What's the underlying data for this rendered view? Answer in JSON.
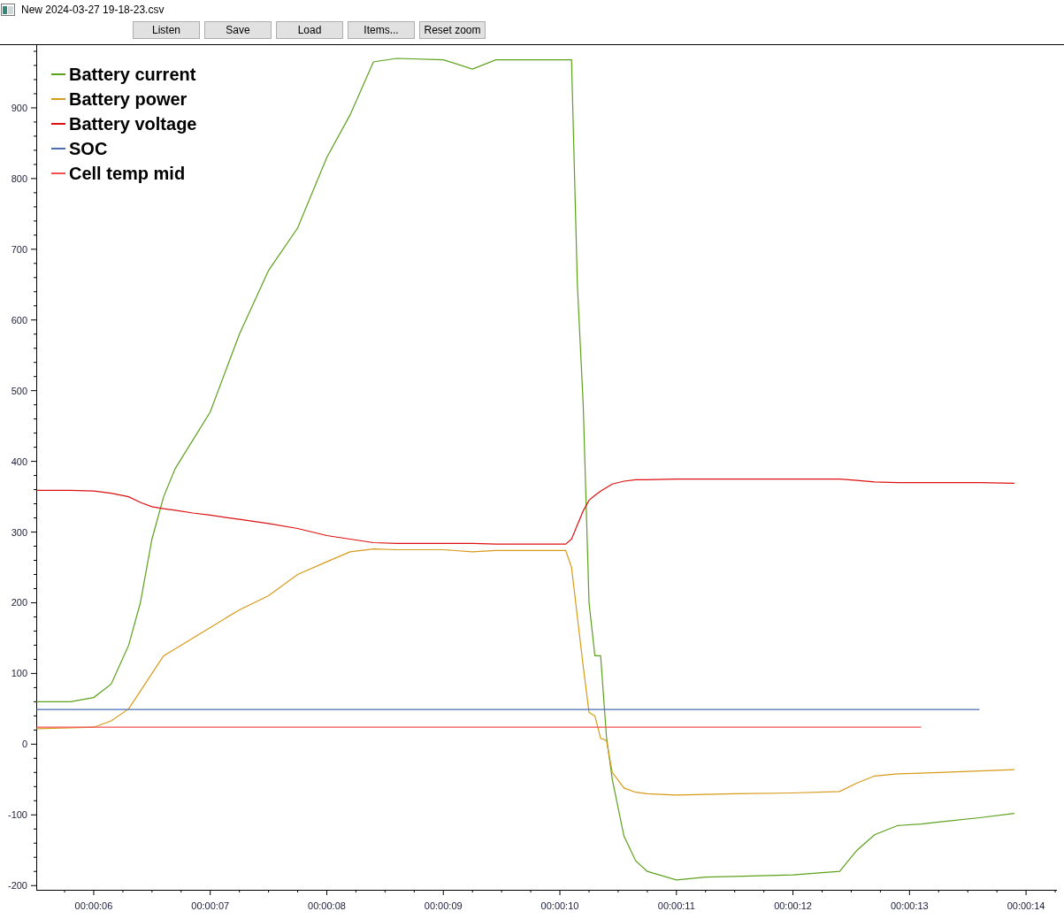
{
  "window": {
    "title": "New 2024-03-27 19-18-23.csv"
  },
  "toolbar": {
    "buttons": [
      "Listen",
      "Save",
      "Load",
      "Items...",
      "Reset zoom"
    ]
  },
  "chart": {
    "chart_data": {
      "type": "line",
      "legend": true,
      "x": [
        5.51,
        5.8,
        6.0,
        6.15,
        6.3,
        6.4,
        6.5,
        6.6,
        6.7,
        6.85,
        7.0,
        7.25,
        7.5,
        7.75,
        8.0,
        8.2,
        8.4,
        8.6,
        9.0,
        9.25,
        9.45,
        9.75,
        10.05,
        10.1,
        10.15,
        10.2,
        10.25,
        10.3,
        10.35,
        10.4,
        10.45,
        10.55,
        10.65,
        10.75,
        11.0,
        11.25,
        11.5,
        12.0,
        12.4,
        12.55,
        12.7,
        12.9,
        13.1,
        13.25,
        13.6,
        13.9
      ],
      "series": [
        {
          "name": "Battery current",
          "color": "#5ca01c",
          "values": [
            60,
            60,
            66,
            85,
            140,
            200,
            290,
            350,
            390,
            430,
            470,
            580,
            670,
            730,
            830,
            890,
            965,
            970,
            968,
            955,
            968,
            968,
            968,
            968,
            650,
            480,
            200,
            125,
            125,
            10,
            -50,
            -130,
            -165,
            -180,
            -192,
            -188,
            -187,
            -185,
            -180,
            -150,
            -128,
            -115,
            -113,
            -110,
            -104,
            -98
          ]
        },
        {
          "name": "Battery power",
          "color": "#d79a1a",
          "values": [
            22,
            23,
            24,
            33,
            50,
            75,
            100,
            125,
            135,
            150,
            165,
            190,
            210,
            240,
            258,
            272,
            276,
            275,
            275,
            272,
            274,
            274,
            274,
            250,
            180,
            110,
            45,
            40,
            8,
            5,
            -40,
            -62,
            -68,
            -70,
            -72,
            -71,
            -70,
            -69,
            -67,
            -55,
            -45,
            -42,
            -41,
            -40,
            -38,
            -36
          ]
        },
        {
          "name": "Battery voltage",
          "color": "#dd1010",
          "values": [
            359,
            359,
            358,
            355,
            350,
            342,
            336,
            333,
            331,
            327,
            324,
            318,
            312,
            305,
            295,
            290,
            285,
            284,
            284,
            284,
            283,
            283,
            283,
            290,
            310,
            330,
            345,
            352,
            358,
            363,
            368,
            372,
            374,
            374,
            375,
            375,
            375,
            375,
            375,
            373,
            371,
            370,
            370,
            370,
            370,
            369
          ]
        },
        {
          "name": "SOC",
          "color": "#4a6eb0",
          "values": [
            49,
            49,
            49,
            49,
            49,
            49,
            49,
            49,
            49,
            49,
            49,
            49,
            49,
            49,
            49,
            49,
            49,
            49,
            49,
            49,
            49,
            49,
            49,
            49,
            49,
            49,
            49,
            49,
            49,
            49,
            49,
            49,
            49,
            49,
            49,
            49,
            49,
            49,
            49,
            49,
            49,
            49,
            49,
            49,
            49,
            null
          ]
        },
        {
          "name": "Cell temp mid",
          "color": "#f05050",
          "values": [
            24,
            24,
            24,
            24,
            24,
            24,
            24,
            24,
            24,
            24,
            24,
            24,
            24,
            24,
            24,
            24,
            24,
            24,
            24,
            24,
            24,
            24,
            24,
            24,
            24,
            24,
            24,
            24,
            24,
            24,
            24,
            24,
            24,
            24,
            24,
            24,
            24,
            24,
            24,
            24,
            24,
            24,
            24,
            null,
            null,
            null
          ]
        }
      ],
      "xlim": [
        5.507,
        14.265
      ],
      "ylim": [
        -206,
        990
      ],
      "xticks": [
        {
          "value": 6,
          "label": "00:00:06"
        },
        {
          "value": 7,
          "label": "00:00:07"
        },
        {
          "value": 8,
          "label": "00:00:08"
        },
        {
          "value": 9,
          "label": "00:00:09"
        },
        {
          "value": 10,
          "label": "00:00:10"
        },
        {
          "value": 11,
          "label": "00:00:11"
        },
        {
          "value": 12,
          "label": "00:00:12"
        },
        {
          "value": 13,
          "label": "00:00:13"
        },
        {
          "value": 14,
          "label": "00:00:14"
        }
      ],
      "yticks": [
        -200,
        -100,
        0,
        100,
        200,
        300,
        400,
        500,
        600,
        700,
        800,
        900
      ]
    }
  }
}
